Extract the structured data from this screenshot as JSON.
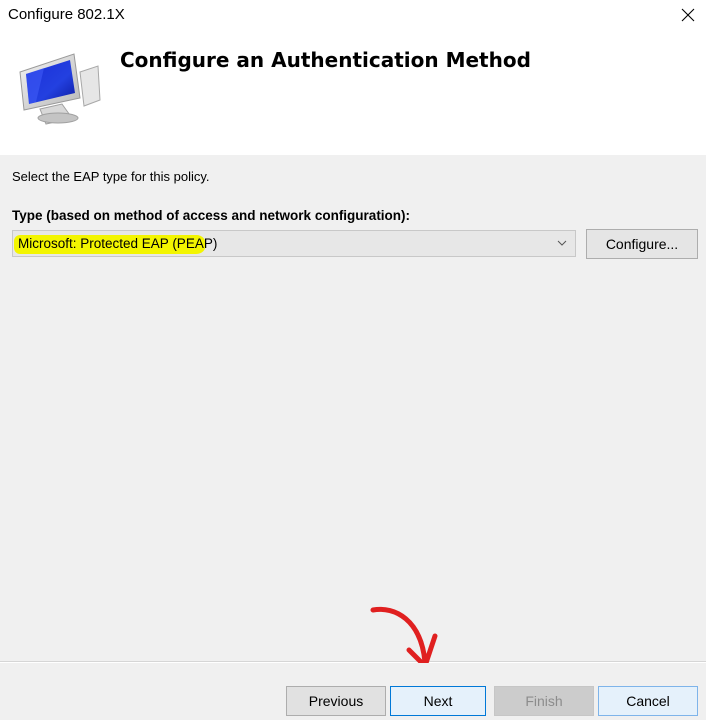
{
  "window": {
    "title": "Configure 802.1X"
  },
  "header": {
    "title": "Configure an Authentication Method",
    "icon": "computer-monitor-icon"
  },
  "content": {
    "instruction": "Select the EAP type for this policy.",
    "type_label": "Type (based on method of access and network configuration):",
    "eap_type": {
      "selected": "Microsoft: Protected EAP (PEAP)"
    },
    "configure_label": "Configure..."
  },
  "footer": {
    "previous_label": "Previous",
    "next_label": "Next",
    "finish_label": "Finish",
    "cancel_label": "Cancel"
  },
  "colors": {
    "highlight": "#f3f500",
    "annotation_arrow": "#e02020",
    "accent": "#0078d7"
  }
}
